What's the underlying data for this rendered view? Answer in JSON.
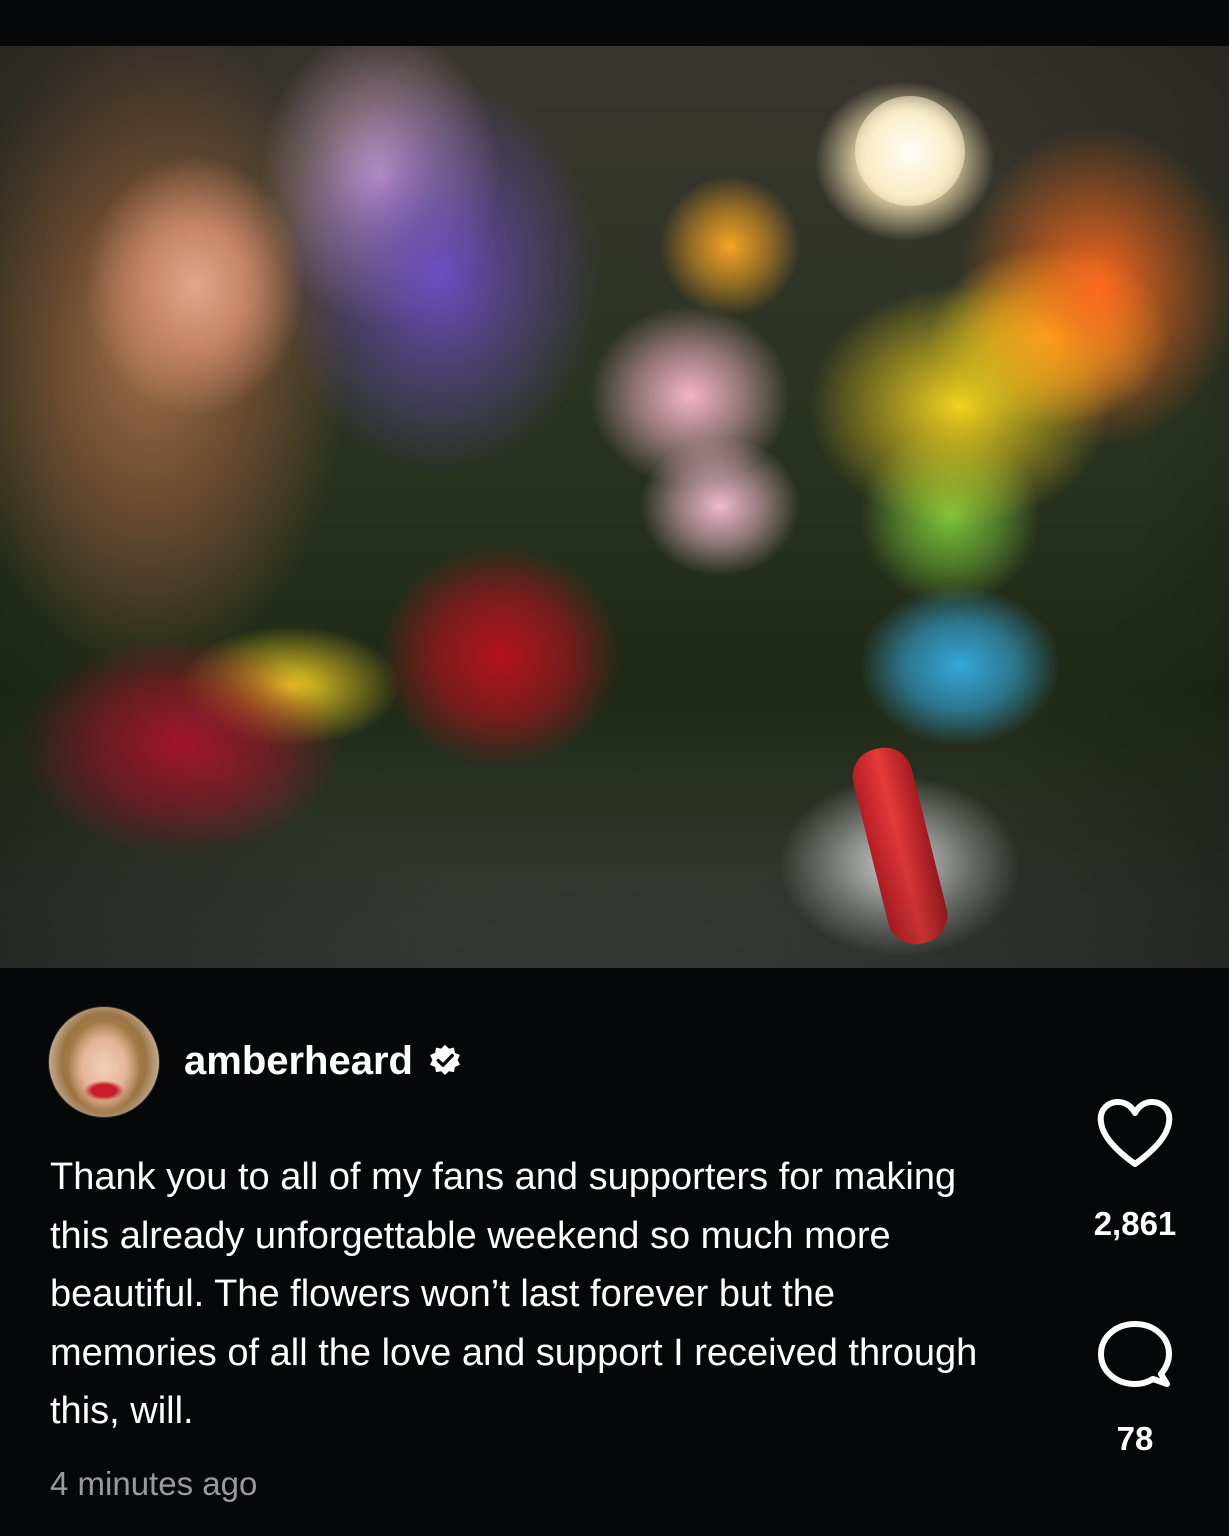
{
  "post": {
    "image": {
      "description_icon": "post-photo"
    },
    "author": {
      "username": "amberheard",
      "verified": true,
      "avatar_icon": "profile-avatar"
    },
    "caption": "Thank you to all of my fans and supporters for making this already unforgettable weekend so much more beautiful. The flowers won’t last forever but the memories of all the love and support I received through this, will.",
    "timestamp": "4 minutes ago"
  },
  "actions": {
    "like": {
      "icon": "heart-icon",
      "count": "2,861"
    },
    "comment": {
      "icon": "comment-bubble-icon",
      "count": "78"
    }
  },
  "colors": {
    "background": "#060708",
    "text_primary": "#ffffff",
    "text_secondary": "#9a9a9a"
  }
}
